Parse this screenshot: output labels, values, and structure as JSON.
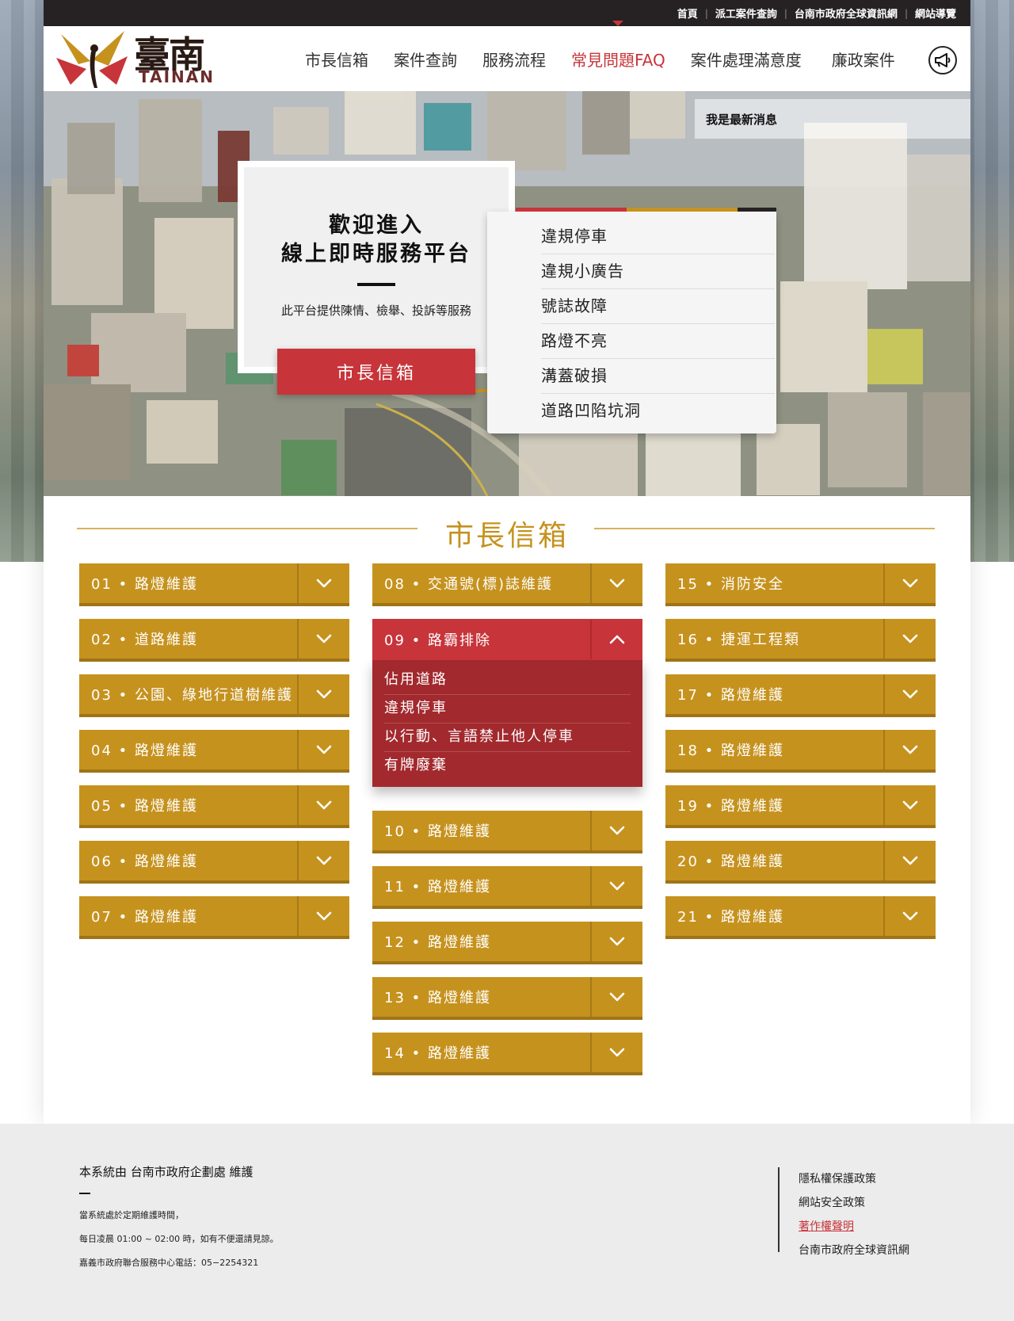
{
  "topbar": {
    "links": [
      "首頁",
      "派工案件查詢",
      "台南市政府全球資訊網",
      "網站導覽"
    ]
  },
  "logo": {
    "text": "TAINAN",
    "chars": "臺南"
  },
  "nav": {
    "items": [
      "市長信箱",
      "案件查詢",
      "服務流程",
      "常見問題FAQ",
      "案件處理滿意度",
      "廉政案件"
    ],
    "active_index": 3,
    "announcement_icon": "megaphone-icon"
  },
  "hero": {
    "news": "我是最新消息",
    "welcome_title_1": "歡迎進入",
    "welcome_title_2": "線上即時服務平台",
    "welcome_desc": "此平台提供陳情、檢舉、投訴等服務",
    "button": "市長信箱",
    "quick_links": [
      "違規停車",
      "違規小廣告",
      "號誌故障",
      "路燈不亮",
      "溝蓋破損",
      "道路凹陷坑洞"
    ]
  },
  "section": {
    "title": "市長信箱"
  },
  "columns": [
    [
      {
        "num": "01",
        "label": "路燈維護"
      },
      {
        "num": "02",
        "label": "道路維護"
      },
      {
        "num": "03",
        "label": "公園、綠地行道樹維護"
      },
      {
        "num": "04",
        "label": "路燈維護"
      },
      {
        "num": "05",
        "label": "路燈維護"
      },
      {
        "num": "06",
        "label": "路燈維護"
      },
      {
        "num": "07",
        "label": "路燈維護"
      }
    ],
    [
      {
        "num": "08",
        "label": "交通號(標)誌維護"
      },
      {
        "num": "09",
        "label": "路霸排除",
        "open": true,
        "sub": [
          "佔用道路",
          "違規停車",
          "以行動、言語禁止他人停車",
          "有牌廢棄"
        ]
      },
      {
        "num": "10",
        "label": "路燈維護"
      },
      {
        "num": "11",
        "label": "路燈維護"
      },
      {
        "num": "12",
        "label": "路燈維護"
      },
      {
        "num": "13",
        "label": "路燈維護"
      },
      {
        "num": "14",
        "label": "路燈維護"
      }
    ],
    [
      {
        "num": "15",
        "label": "消防安全"
      },
      {
        "num": "16",
        "label": "捷運工程類"
      },
      {
        "num": "17",
        "label": "路燈維護"
      },
      {
        "num": "18",
        "label": "路燈維護"
      },
      {
        "num": "19",
        "label": "路燈維護"
      },
      {
        "num": "20",
        "label": "路燈維護"
      },
      {
        "num": "21",
        "label": "路燈維護"
      }
    ]
  ],
  "footer": {
    "title": "本系統由 台南市政府企劃處 維護",
    "line1": "當系統處於定期維護時間，",
    "line2": "每日凌晨 01:00 ~ 02:00 時，如有不便還請見諒。",
    "line3": "嘉義市政府聯合服務中心電話：05−2254321",
    "links": [
      "隱私權保護政策",
      "網站安全政策",
      "著作權聲明",
      "台南市政府全球資訊網"
    ],
    "active_link_index": 2
  },
  "colors": {
    "gold": "#c6921e",
    "red": "#c7343a",
    "dark_red": "#a2292d",
    "topbar": "#262223"
  }
}
